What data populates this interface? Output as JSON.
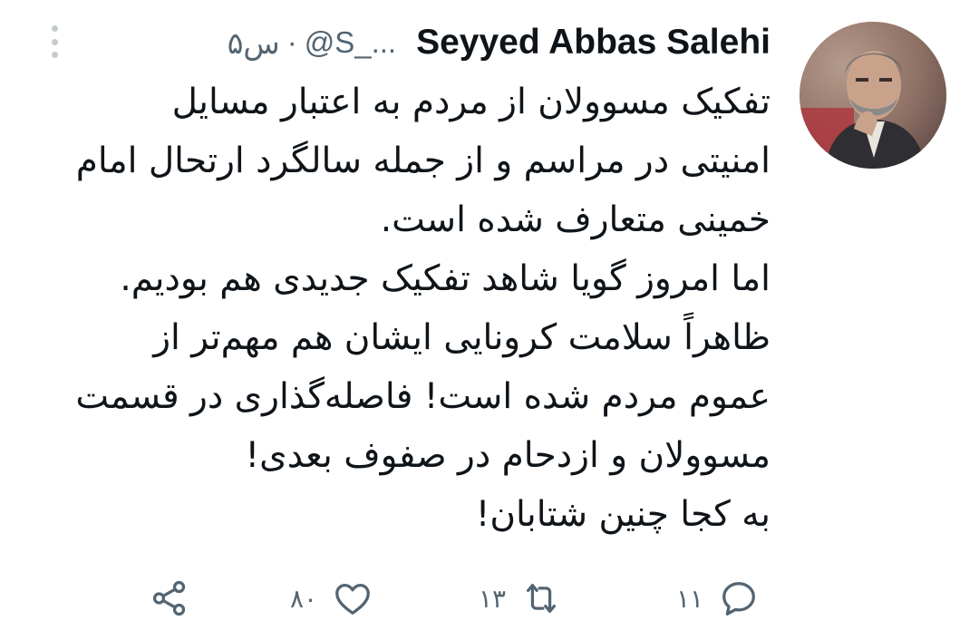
{
  "tweet": {
    "author": {
      "display_name": "Seyyed Abbas Salehi",
      "handle": "@S_...",
      "separator": "·",
      "time": "۵س"
    },
    "body_lines": [
      "تفکیک مسوولان از مردم به اعتبار مسایل",
      "امنیتی در مراسم و از جمله سالگرد ارتحال امام",
      "خمینی متعارف شده است.",
      "اما امروز  گویا شاهد تفکیک جدیدی هم بودیم.",
      "ظاهراً سلامت کرونایی ایشان هم مهم‌تر از",
      "عموم مردم شده است! فاصله‌گذاری در قسمت",
      "مسوولان و ازدحام در صفوف  بعدی!",
      "به کجا چنین شتابان!"
    ],
    "actions": {
      "reply_count": "۱۱",
      "retweet_count": "۱۳",
      "like_count": "۸۰"
    },
    "icons": {
      "avatar": "profile-photo",
      "more": "more-vertical-icon",
      "reply": "reply-icon",
      "retweet": "retweet-icon",
      "like": "heart-icon",
      "share": "share-icon"
    },
    "colors": {
      "text": "#0f1419",
      "secondary": "#536471",
      "background": "#ffffff"
    }
  }
}
